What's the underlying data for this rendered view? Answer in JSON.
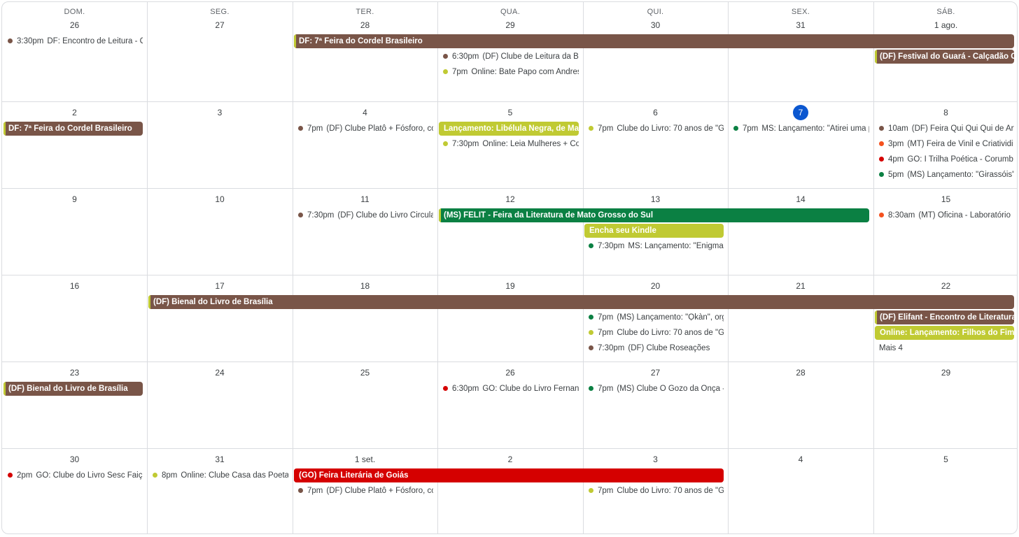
{
  "weekday_headers": [
    "DOM.",
    "SEG.",
    "TER.",
    "QUA.",
    "QUI.",
    "SEX.",
    "SÁB."
  ],
  "colors": {
    "brown": "#795548",
    "olive": "#c0ca33",
    "green": "#0b8043",
    "red": "#d50000",
    "orange": "#f4511e",
    "today": "#0b57d0"
  },
  "weeks": [
    {
      "days": [
        "26",
        "27",
        "28",
        "29",
        "30",
        "31",
        "1 ago."
      ],
      "spans": [
        {
          "col": 2,
          "len": 5,
          "row": 0,
          "label": "DF: 7ª Feira do Cordel Brasileiro",
          "color": "brown",
          "stripe": "olive"
        },
        {
          "col": 6,
          "len": 1,
          "row": 1,
          "label": "(DF) Festival do Guará - Calçadão C",
          "color": "brown",
          "stripe": "olive"
        }
      ],
      "events": [
        {
          "col": 0,
          "row": 0,
          "time": "3:30pm",
          "title": "DF: Encontro de Leitura - C",
          "color": "brown"
        },
        {
          "col": 3,
          "row": 1,
          "time": "6:30pm",
          "title": "(DF) Clube de Leitura da B",
          "color": "brown"
        },
        {
          "col": 3,
          "row": 2,
          "time": "7pm",
          "title": "Online: Bate Papo com Andres",
          "color": "olive"
        }
      ]
    },
    {
      "days": [
        "2",
        "3",
        "4",
        "5",
        "6",
        "7",
        "8"
      ],
      "today_col": 5,
      "spans": [
        {
          "col": 0,
          "len": 1,
          "row": 0,
          "label": "DF: 7ª Feira do Cordel Brasileiro",
          "color": "brown",
          "stripe": "olive"
        },
        {
          "col": 3,
          "len": 1,
          "row": 0,
          "label": "Lançamento: Libélula Negra, de Mal",
          "color": "olive",
          "stripe": "olive"
        }
      ],
      "events": [
        {
          "col": 2,
          "row": 0,
          "time": "7pm",
          "title": "(DF) Clube Platô + Fósforo, cc",
          "color": "brown"
        },
        {
          "col": 3,
          "row": 1,
          "time": "7:30pm",
          "title": "Online: Leia Mulheres + Co",
          "color": "olive"
        },
        {
          "col": 4,
          "row": 0,
          "time": "7pm",
          "title": "Clube do Livro: 70 anos de \"G",
          "color": "olive"
        },
        {
          "col": 5,
          "row": 0,
          "time": "7pm",
          "title": "MS: Lançamento: \"Atirei uma p",
          "color": "green"
        },
        {
          "col": 6,
          "row": 0,
          "time": "10am",
          "title": "(DF) Feira Qui Qui Qui de Art",
          "color": "brown"
        },
        {
          "col": 6,
          "row": 1,
          "time": "3pm",
          "title": "(MT) Feira de Vinil e Criatividi",
          "color": "orange"
        },
        {
          "col": 6,
          "row": 2,
          "time": "4pm",
          "title": "GO: I Trilha Poética - Corumb",
          "color": "red"
        },
        {
          "col": 6,
          "row": 3,
          "time": "5pm",
          "title": "(MS) Lançamento: \"Girassóis\"",
          "color": "green"
        }
      ]
    },
    {
      "days": [
        "9",
        "10",
        "11",
        "12",
        "13",
        "14",
        "15"
      ],
      "spans": [
        {
          "col": 3,
          "len": 3,
          "row": 0,
          "label": "(MS) FELIT - Feira da Literatura de Mato Grosso do Sul",
          "color": "green",
          "stripe": "olive"
        },
        {
          "col": 4,
          "len": 1,
          "row": 1,
          "label": "Encha seu Kindle",
          "color": "olive",
          "stripe": "olive"
        }
      ],
      "events": [
        {
          "col": 2,
          "row": 0,
          "time": "7:30pm",
          "title": "(DF) Clube do Livro Circula",
          "color": "brown"
        },
        {
          "col": 4,
          "row": 2,
          "time": "7:30pm",
          "title": "MS: Lançamento: \"Enigmas",
          "color": "green"
        },
        {
          "col": 6,
          "row": 0,
          "time": "8:30am",
          "title": "(MT) Oficina - Laboratório",
          "color": "orange"
        }
      ]
    },
    {
      "days": [
        "16",
        "17",
        "18",
        "19",
        "20",
        "21",
        "22"
      ],
      "spans": [
        {
          "col": 1,
          "len": 6,
          "row": 0,
          "label": "(DF) Bienal do Livro de Brasília",
          "color": "brown",
          "stripe": "olive"
        },
        {
          "col": 6,
          "len": 1,
          "row": 1,
          "label": "(DF) Elifant - Encontro de Literatura",
          "color": "brown",
          "stripe": "olive"
        },
        {
          "col": 6,
          "len": 1,
          "row": 2,
          "label": "Online: Lançamento: Filhos do Fim c",
          "color": "olive",
          "stripe": "olive"
        }
      ],
      "events": [
        {
          "col": 4,
          "row": 1,
          "time": "7pm",
          "title": "(MS) Lançamento: \"Ọkàn\", org",
          "color": "green"
        },
        {
          "col": 4,
          "row": 2,
          "time": "7pm",
          "title": "Clube do Livro: 70 anos de \"G",
          "color": "olive"
        },
        {
          "col": 4,
          "row": 3,
          "time": "7:30pm",
          "title": "(DF) Clube Roseações",
          "color": "brown"
        }
      ],
      "more": {
        "col": 6,
        "row": 3,
        "label": "Mais 4"
      }
    },
    {
      "days": [
        "23",
        "24",
        "25",
        "26",
        "27",
        "28",
        "29"
      ],
      "spans": [
        {
          "col": 0,
          "len": 1,
          "row": 0,
          "label": "(DF) Bienal do Livro de Brasília",
          "color": "brown",
          "stripe": "olive"
        }
      ],
      "events": [
        {
          "col": 3,
          "row": 0,
          "time": "6:30pm",
          "title": "GO: Clube do Livro Fernan",
          "color": "red"
        },
        {
          "col": 4,
          "row": 0,
          "time": "7pm",
          "title": "(MS) Clube O Gozo da Onça -",
          "color": "green"
        }
      ]
    },
    {
      "days": [
        "30",
        "31",
        "1 set.",
        "2",
        "3",
        "4",
        "5"
      ],
      "spans": [
        {
          "col": 2,
          "len": 3,
          "row": 0,
          "label": "(GO) Feira Literária de Goiás",
          "color": "red",
          "stripe": "red"
        }
      ],
      "events": [
        {
          "col": 0,
          "row": 0,
          "time": "2pm",
          "title": "GO: Clube do Livro Sesc Faiça",
          "color": "red"
        },
        {
          "col": 1,
          "row": 0,
          "time": "8pm",
          "title": "Online: Clube Casa das Poeta",
          "color": "olive"
        },
        {
          "col": 2,
          "row": 1,
          "time": "7pm",
          "title": "(DF) Clube Platô + Fósforo, cc",
          "color": "brown"
        },
        {
          "col": 4,
          "row": 1,
          "time": "7pm",
          "title": "Clube do Livro: 70 anos de \"G",
          "color": "olive"
        }
      ]
    }
  ]
}
